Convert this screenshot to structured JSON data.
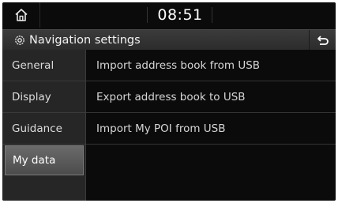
{
  "statusbar": {
    "home_icon": "home-icon",
    "time": "08:51"
  },
  "titlebar": {
    "icon": "gear-icon",
    "title": "Navigation settings",
    "back_icon": "back-arrow-icon"
  },
  "sidebar": {
    "items": [
      {
        "label": "General"
      },
      {
        "label": "Display"
      },
      {
        "label": "Guidance"
      },
      {
        "label": "My data",
        "selected": true
      }
    ]
  },
  "main": {
    "items": [
      {
        "label": "Import address book from USB"
      },
      {
        "label": "Export address book to USB"
      },
      {
        "label": "Import My POI from USB"
      }
    ]
  }
}
